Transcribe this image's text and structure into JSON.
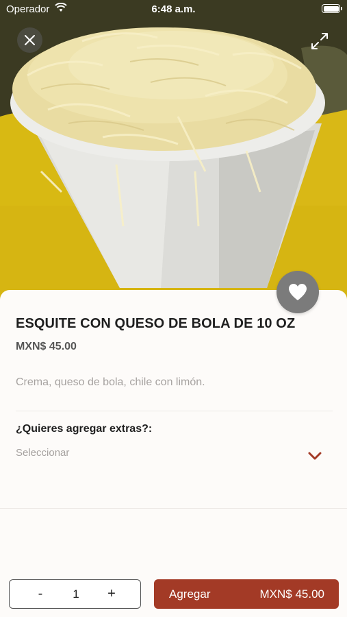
{
  "status_bar": {
    "carrier": "Operador",
    "time": "6:48 a.m."
  },
  "product": {
    "title": "ESQUITE CON QUESO DE BOLA DE 10 OZ",
    "price": "MXN$ 45.00",
    "description": "Crema, queso de bola, chile con limón."
  },
  "extras": {
    "label": "¿Quieres agregar extras?:",
    "placeholder": "Seleccionar"
  },
  "footer": {
    "minus_label": "-",
    "quantity": "1",
    "plus_label": "+",
    "add_label": "Agregar",
    "add_total": "MXN$ 45.00"
  },
  "colors": {
    "accent": "#a33a26",
    "favorite_bg": "#7b7b7b",
    "background": "#fdfbf9"
  },
  "icons": {
    "close": "close-icon",
    "expand": "expand-icon",
    "favorite": "heart-icon",
    "dropdown": "chevron-down-icon",
    "wifi": "wifi-icon",
    "battery": "battery-icon"
  }
}
